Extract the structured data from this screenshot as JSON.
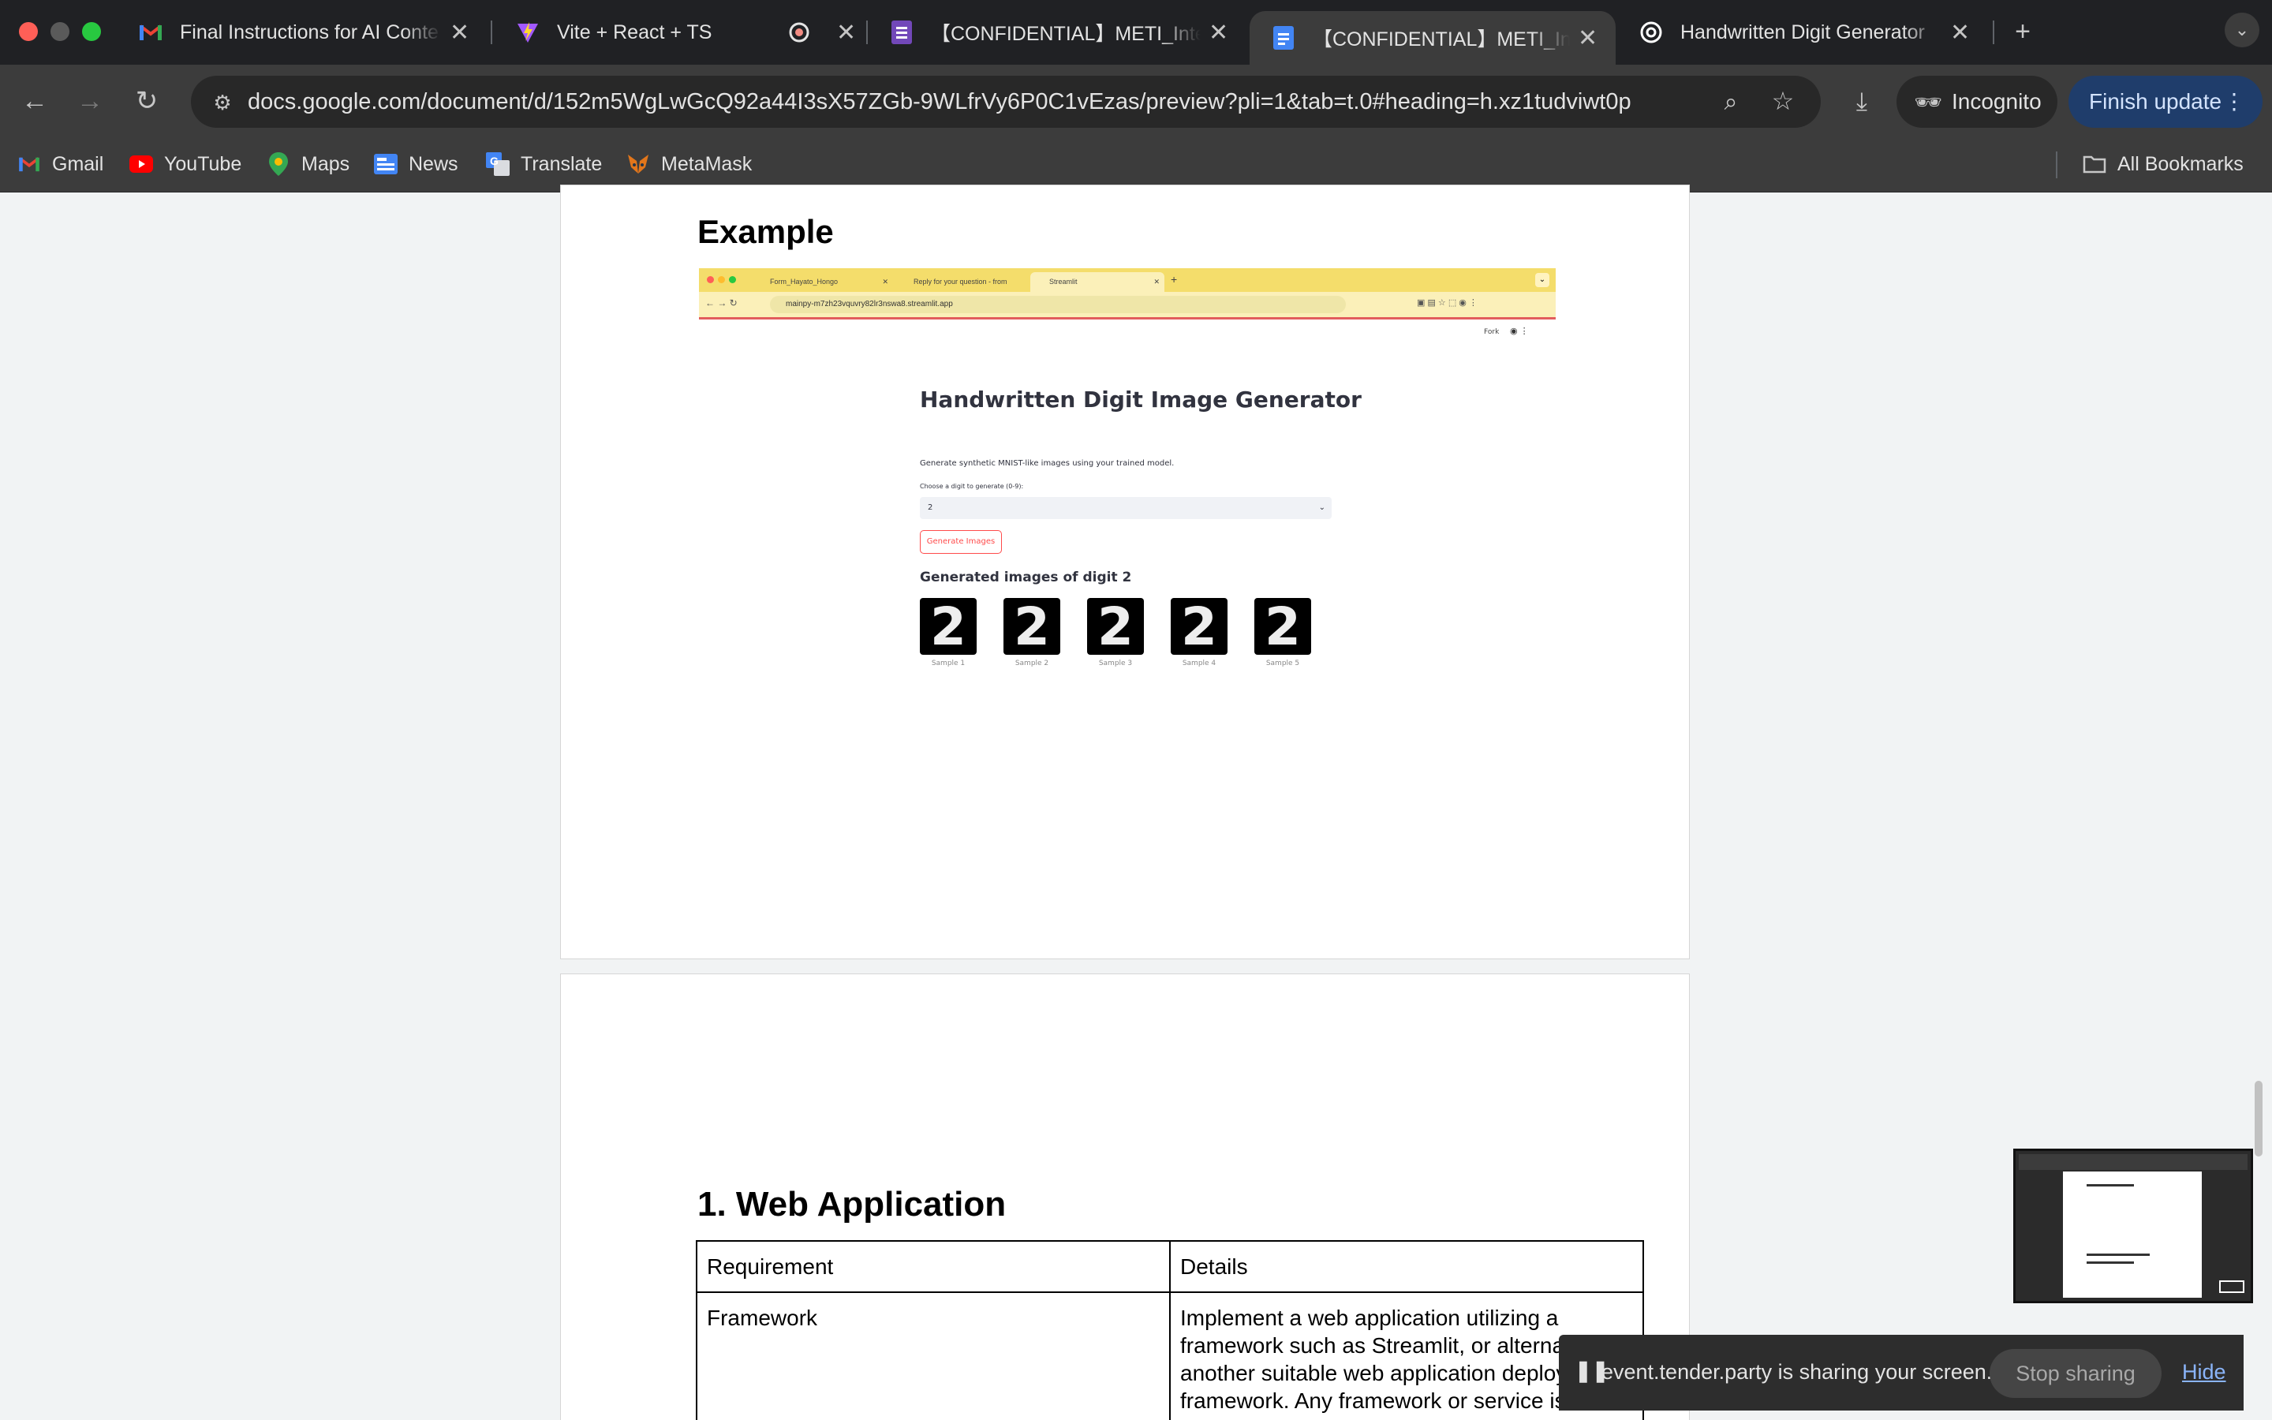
{
  "browser": {
    "tabs": [
      {
        "title": "Final Instructions for AI Conte",
        "icon": "gmail-icon"
      },
      {
        "title": "Vite + React + TS",
        "icon": "vite-icon"
      },
      {
        "title": "",
        "icon": "recording-icon"
      },
      {
        "title": "【CONFIDENTIAL】METI_Inte",
        "icon": "forms-icon"
      },
      {
        "title": "【CONFIDENTIAL】METI_Inte",
        "icon": "docs-icon",
        "active": true
      },
      {
        "title": "Handwritten Digit Generator",
        "icon": "openai-icon"
      }
    ],
    "new_tab": "+",
    "url": "docs.google.com/document/d/152m5WgLwGcQ92a44I3sX57ZGb-9WLfrVy6P0C1vEzas/preview?pli=1&tab=t.0#heading=h.xz1tudviwt0p",
    "incognito_label": "Incognito",
    "finish_update_label": "Finish update",
    "bookmarks": [
      {
        "label": "Gmail",
        "icon": "gmail-icon"
      },
      {
        "label": "YouTube",
        "icon": "youtube-icon"
      },
      {
        "label": "Maps",
        "icon": "maps-icon"
      },
      {
        "label": "News",
        "icon": "news-icon"
      },
      {
        "label": "Translate",
        "icon": "translate-icon"
      },
      {
        "label": "MetaMask",
        "icon": "metamask-icon"
      }
    ],
    "all_bookmarks_label": "All Bookmarks"
  },
  "document": {
    "example_heading": "Example",
    "section_heading": "1. Web Application",
    "table": {
      "headers": [
        "Requirement",
        "Details"
      ],
      "rows": [
        {
          "requirement": "Framework",
          "details_lines": [
            "Implement a web application utilizing a",
            "framework such as Streamlit, or alternatively,",
            "another suitable web application deployment",
            "framework. Any framework or service is fine."
          ]
        }
      ]
    }
  },
  "embedded_screenshot": {
    "tabs": [
      "Form_Hayato_Hongo",
      "Reply for your question - from",
      "Streamlit"
    ],
    "url": "mainpy-m7zh23vquvry82lr3nswa8.streamlit.app",
    "fork_label": "Fork",
    "app_title": "Handwritten Digit Image Generator",
    "description": "Generate synthetic MNIST-like images using your trained model.",
    "select_label": "Choose a digit to generate (0-9):",
    "select_value": "2",
    "button_label": "Generate Images",
    "results_heading": "Generated images of digit 2",
    "sample_digit": "2",
    "samples": [
      "Sample 1",
      "Sample 2",
      "Sample 3",
      "Sample 4",
      "Sample 5"
    ]
  },
  "share_banner": {
    "message": "event.tender.party is sharing your screen.",
    "stop_label": "Stop sharing",
    "hide_label": "Hide"
  }
}
